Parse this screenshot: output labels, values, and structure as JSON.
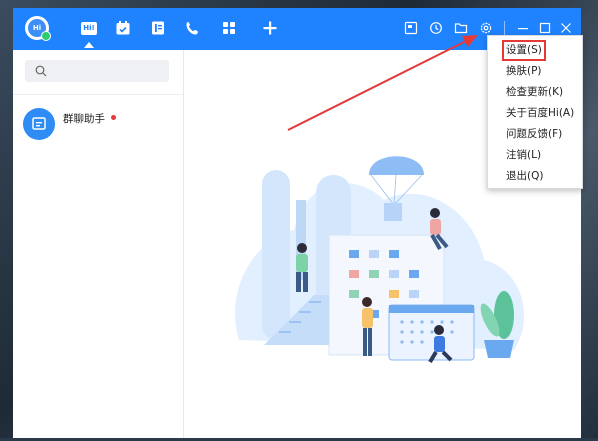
{
  "app": {
    "avatar_text": "Hi",
    "tab_active_label": "Hi!"
  },
  "titlebar": {
    "tabs": [
      "message-icon",
      "calendar-icon",
      "contacts-icon",
      "phone-icon",
      "apps-icon",
      "add-icon"
    ],
    "tools": [
      "notes-icon",
      "history-icon",
      "folder-icon",
      "gear-icon"
    ],
    "window_controls": [
      "minimize-icon",
      "maximize-icon",
      "close-icon"
    ]
  },
  "sidebar": {
    "conversations": [
      {
        "name": "群聊助手",
        "unread": true
      }
    ]
  },
  "menu": {
    "items": [
      {
        "label": "设置(S)",
        "highlighted": true
      },
      {
        "label": "换肤(P)"
      },
      {
        "label": "检查更新(K)"
      },
      {
        "label": "关于百度Hi(A)"
      },
      {
        "label": "问题反馈(F)"
      },
      {
        "label": "注销(L)"
      },
      {
        "label": "退出(Q)"
      }
    ]
  },
  "colors": {
    "brand": "#1f83ff",
    "highlight": "#e53935",
    "unread_dot": "#e53935"
  }
}
